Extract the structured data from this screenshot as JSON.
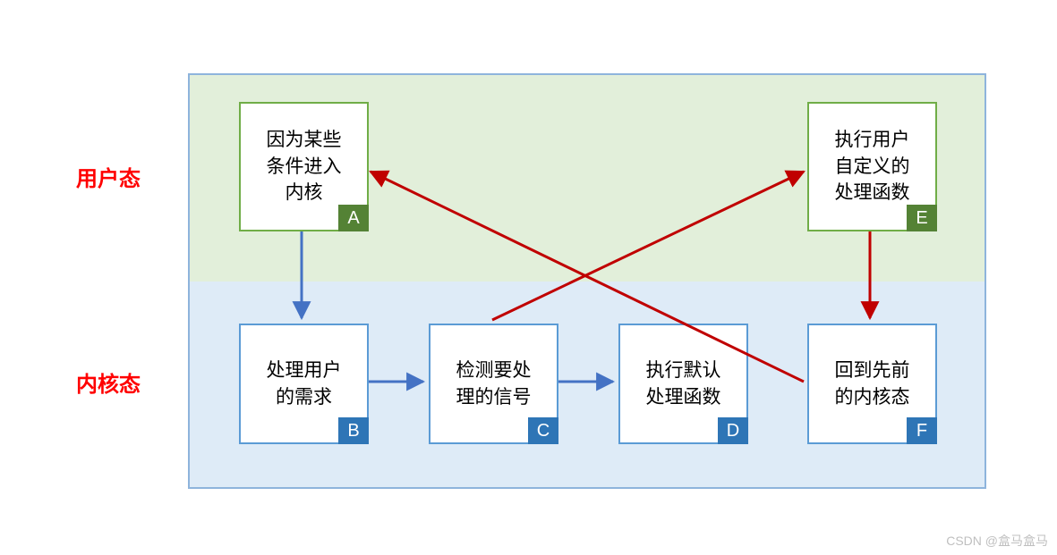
{
  "labels": {
    "user_mode": "用户态",
    "kernel_mode": "内核态"
  },
  "boxes": {
    "A": {
      "text": "因为某些\n条件进入\n内核",
      "badge": "A"
    },
    "B": {
      "text": "处理用户\n的需求",
      "badge": "B"
    },
    "C": {
      "text": "检测要处\n理的信号",
      "badge": "C"
    },
    "D": {
      "text": "执行默认\n处理函数",
      "badge": "D"
    },
    "E": {
      "text": "执行用户\n自定义的\n处理函数",
      "badge": "E"
    },
    "F": {
      "text": "回到先前\n的内核态",
      "badge": "F"
    }
  },
  "watermark": "CSDN @盒马盒马",
  "arrows": [
    {
      "from": "A",
      "to": "B",
      "color": "blue"
    },
    {
      "from": "B",
      "to": "C",
      "color": "blue"
    },
    {
      "from": "C",
      "to": "D",
      "color": "blue"
    },
    {
      "from": "C",
      "to": "E",
      "color": "red"
    },
    {
      "from": "E",
      "to": "F",
      "color": "red"
    },
    {
      "from": "F",
      "to": "A",
      "color": "red"
    }
  ]
}
